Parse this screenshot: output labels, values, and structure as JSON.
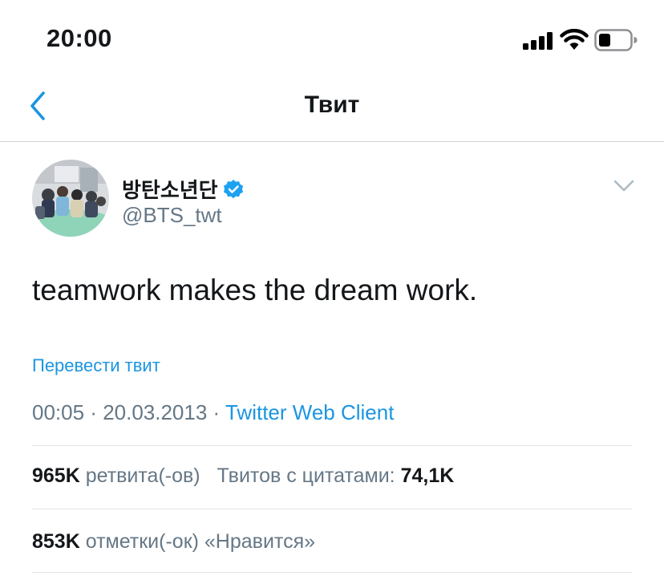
{
  "status_bar": {
    "time": "20:00",
    "icons": [
      "signal-icon",
      "wifi-icon",
      "battery-icon"
    ]
  },
  "nav": {
    "back_icon": "chevron-left-icon",
    "title": "Твит"
  },
  "tweet": {
    "author_name": "방탄소년단",
    "verified_icon": "verified-icon",
    "handle": "@BTS_twt",
    "text": "teamwork makes the dream work.",
    "translate_label": "Перевести твит",
    "time": "00:05",
    "separator": " · ",
    "date": "20.03.2013",
    "source": "Twitter Web Client"
  },
  "stats": {
    "retweets_count": "965K",
    "retweets_label": "ретвита(-ов)",
    "quotes_label": "Твитов с цитатами:",
    "quotes_count": "74,1K",
    "likes_count": "853K",
    "likes_label": "отметки(-ок) «Нравится»"
  },
  "colors": {
    "accent": "#1b95e0",
    "secondary_text": "#657786",
    "primary_text": "#14171a",
    "divider": "#dfe3e6"
  }
}
